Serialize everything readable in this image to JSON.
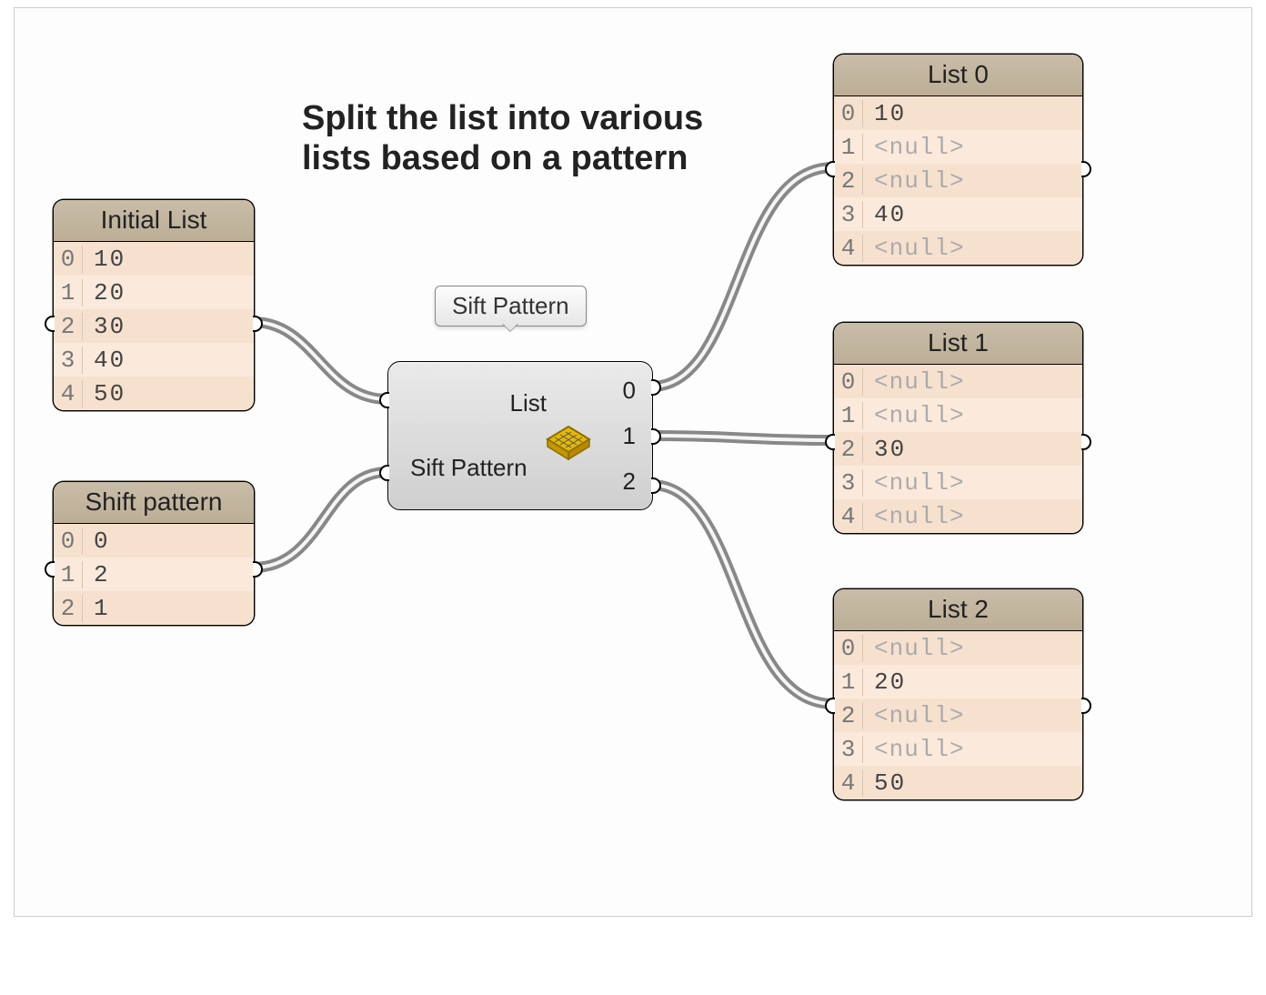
{
  "title_line1": "Split the list into various",
  "title_line2": "lists based on a pattern",
  "panels": {
    "initial": {
      "title": "Initial List",
      "rows": [
        {
          "idx": "0",
          "val": "10"
        },
        {
          "idx": "1",
          "val": "20"
        },
        {
          "idx": "2",
          "val": "30"
        },
        {
          "idx": "3",
          "val": "40"
        },
        {
          "idx": "4",
          "val": "50"
        }
      ]
    },
    "shiftpattern": {
      "title": "Shift pattern",
      "rows": [
        {
          "idx": "0",
          "val": "0"
        },
        {
          "idx": "1",
          "val": "2"
        },
        {
          "idx": "2",
          "val": "1"
        }
      ]
    },
    "list0": {
      "title": "List 0",
      "rows": [
        {
          "idx": "0",
          "val": "10"
        },
        {
          "idx": "1",
          "val": "<null>",
          "null": true
        },
        {
          "idx": "2",
          "val": "<null>",
          "null": true
        },
        {
          "idx": "3",
          "val": "40"
        },
        {
          "idx": "4",
          "val": "<null>",
          "null": true
        }
      ]
    },
    "list1": {
      "title": "List 1",
      "rows": [
        {
          "idx": "0",
          "val": "<null>",
          "null": true
        },
        {
          "idx": "1",
          "val": "<null>",
          "null": true
        },
        {
          "idx": "2",
          "val": "30"
        },
        {
          "idx": "3",
          "val": "<null>",
          "null": true
        },
        {
          "idx": "4",
          "val": "<null>",
          "null": true
        }
      ]
    },
    "list2": {
      "title": "List 2",
      "rows": [
        {
          "idx": "0",
          "val": "<null>",
          "null": true
        },
        {
          "idx": "1",
          "val": "20"
        },
        {
          "idx": "2",
          "val": "<null>",
          "null": true
        },
        {
          "idx": "3",
          "val": "<null>",
          "null": true
        },
        {
          "idx": "4",
          "val": "50"
        }
      ]
    }
  },
  "component": {
    "tooltip": "Sift Pattern",
    "input_list": "List",
    "input_pattern": "Sift Pattern",
    "out0": "0",
    "out1": "1",
    "out2": "2"
  }
}
